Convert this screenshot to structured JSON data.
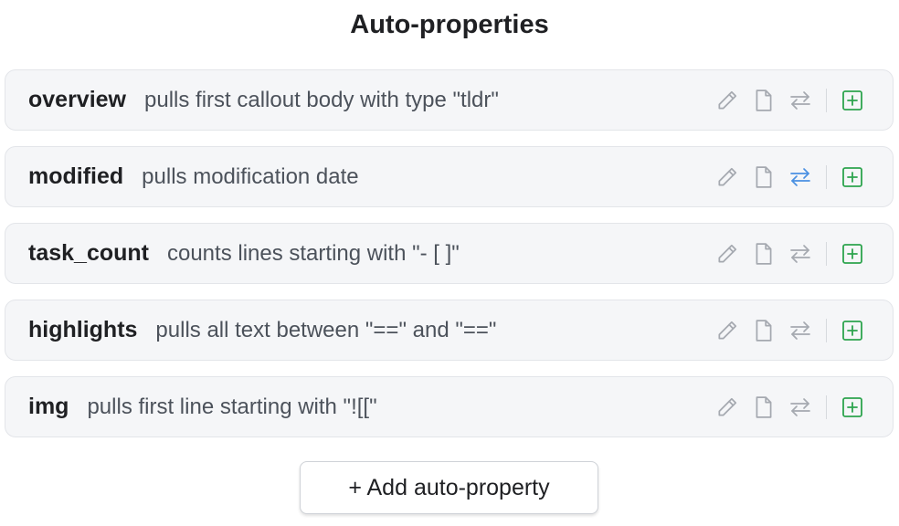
{
  "header": {
    "title": "Auto-properties"
  },
  "colors": {
    "icon_muted": "#a5a9b0",
    "icon_active": "#4a90e2",
    "icon_add": "#2da44e"
  },
  "rows": [
    {
      "name": "overview",
      "description": "pulls first callout body with type \"tldr\"",
      "swap_active": false
    },
    {
      "name": "modified",
      "description": "pulls modification date",
      "swap_active": true
    },
    {
      "name": "task_count",
      "description": "counts lines starting with \"- [ ]\"",
      "swap_active": false
    },
    {
      "name": "highlights",
      "description": "pulls all text between \"==\" and \"==\"",
      "swap_active": false
    },
    {
      "name": "img",
      "description": "pulls first line starting with \"![[\"",
      "swap_active": false
    }
  ],
  "row_icons": [
    "pencil-icon",
    "file-icon",
    "swap-arrows-icon",
    "plus-square-icon"
  ],
  "footer": {
    "add_label": "+ Add auto-property"
  }
}
